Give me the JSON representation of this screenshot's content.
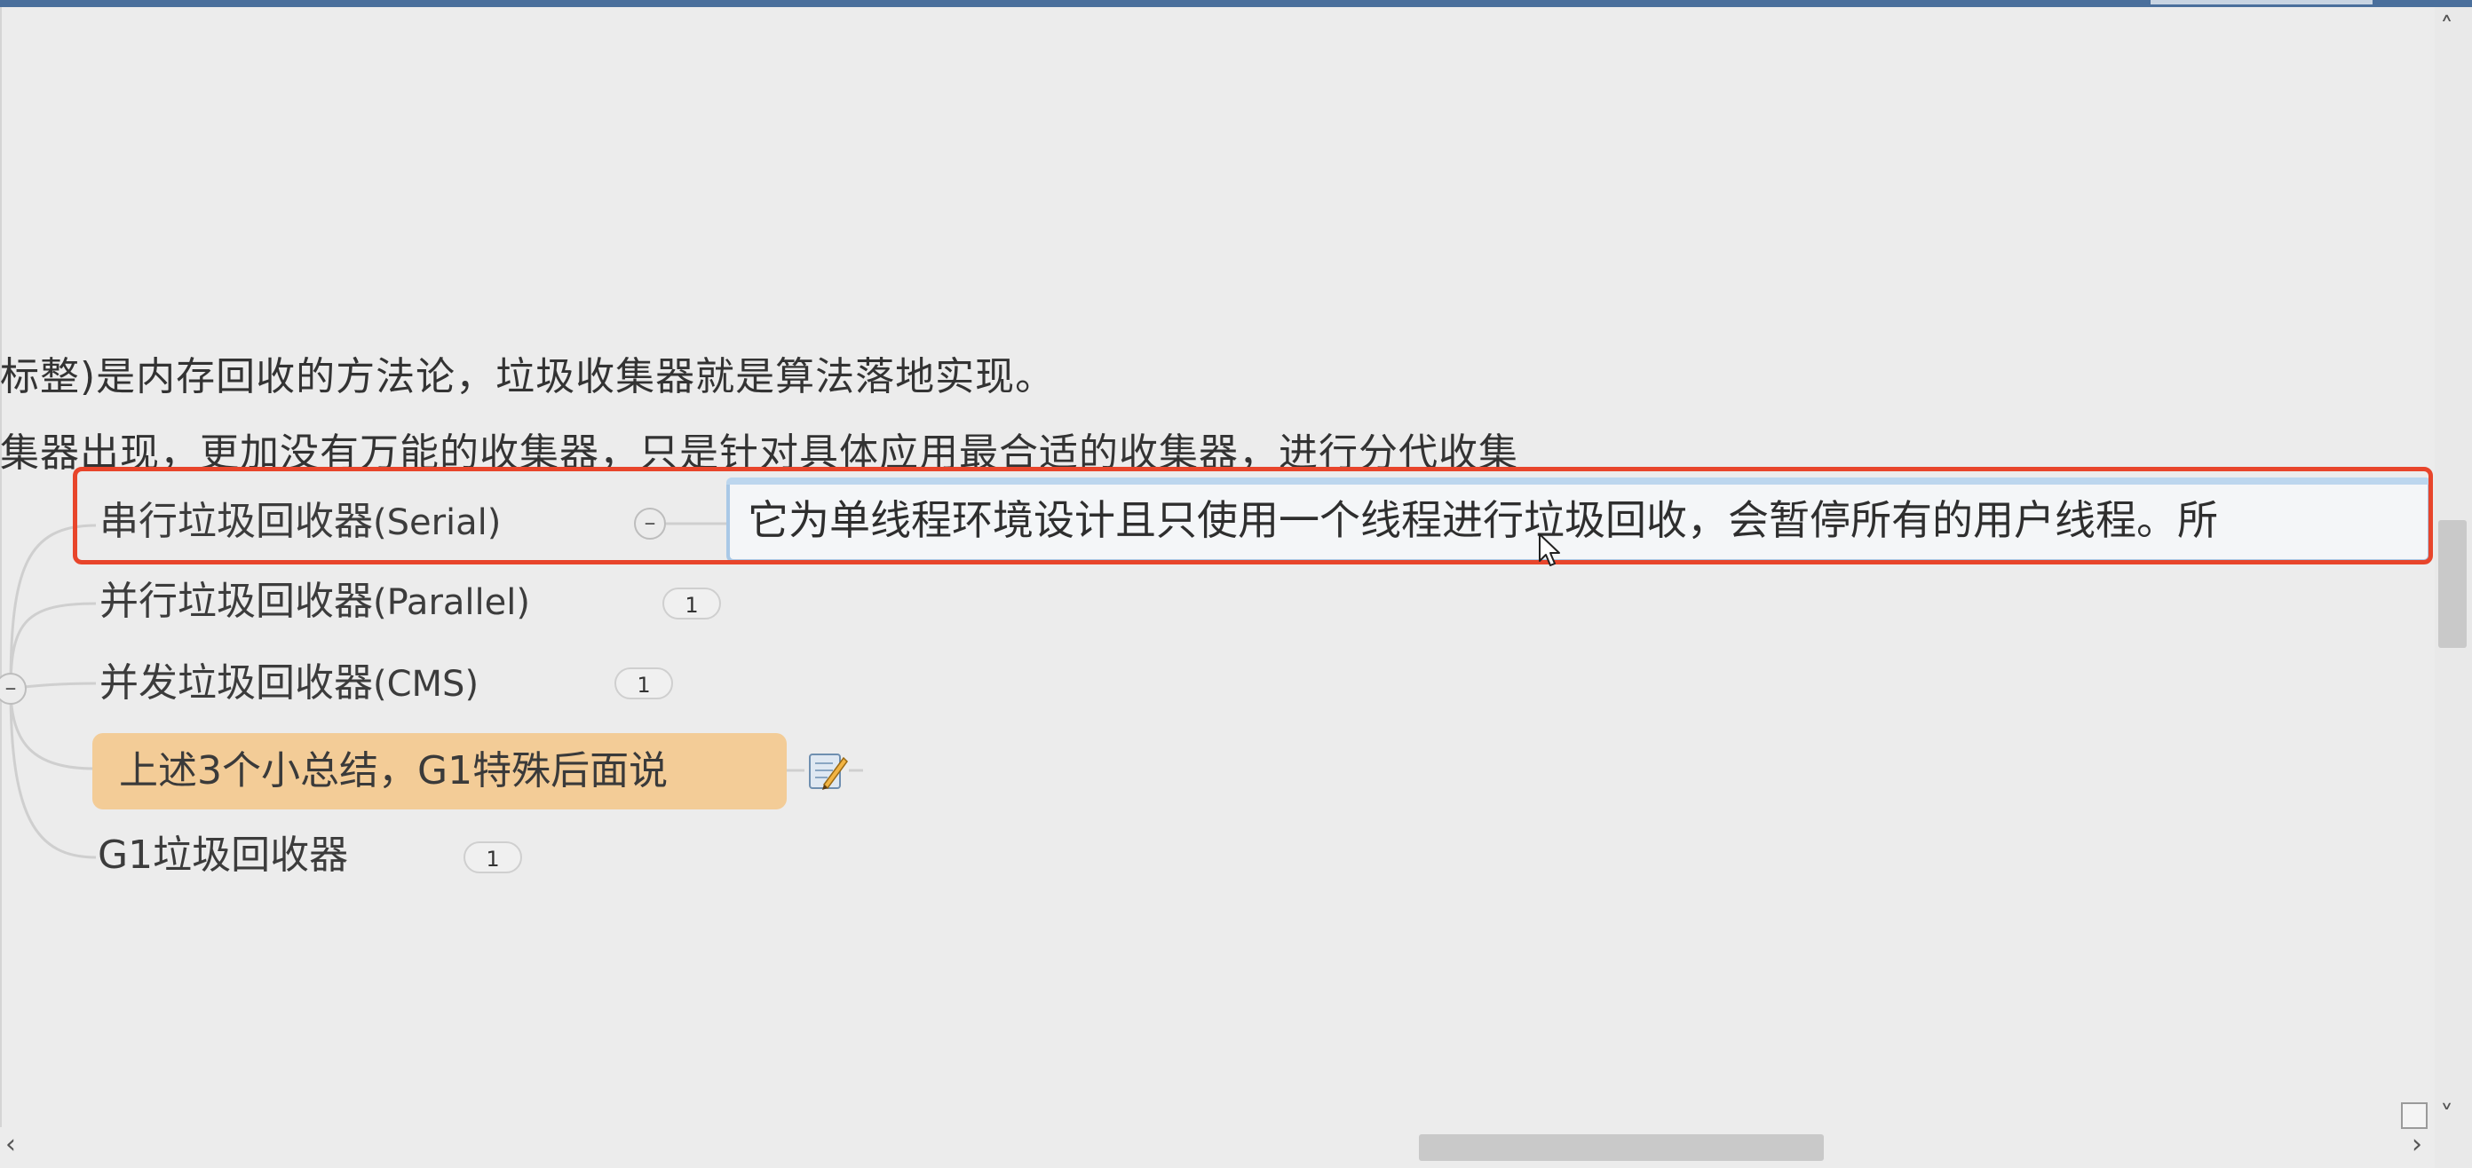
{
  "context_lines": [
    "标整)是内存回收的方法论，垃圾收集器就是算法落地实现。",
    "集器出现，更加没有万能的收集器，只是针对具体应用最合适的收集器，进行分代收集"
  ],
  "topics": {
    "serial": {
      "label": "串行垃圾回收器",
      "latin": "(Serial)"
    },
    "parallel": {
      "label": "并行垃圾回收器",
      "latin": "(Parallel)",
      "badge": "1"
    },
    "cms": {
      "label": "并发垃圾回收器",
      "latin": "(CMS)",
      "badge": "1"
    },
    "summary": {
      "label": "上述3个小总结，G1特殊后面说"
    },
    "g1": {
      "label": "G1垃圾回收器",
      "badge": "1"
    }
  },
  "collapse_symbols": {
    "serial": "–",
    "parent": "–"
  },
  "note_editor": {
    "text": "它为单线程环境设计且只使用一个线程进行垃圾回收，会暂停所有的用户线程。所"
  },
  "scrollbars": {
    "up_arrow": "˄",
    "down_arrow": "˅",
    "left_arrow": "‹",
    "right_arrow": "›"
  },
  "colors": {
    "highlight": "#e8452b",
    "summary_fill": "#f3cc97",
    "editor_border": "#a9c8e6"
  }
}
